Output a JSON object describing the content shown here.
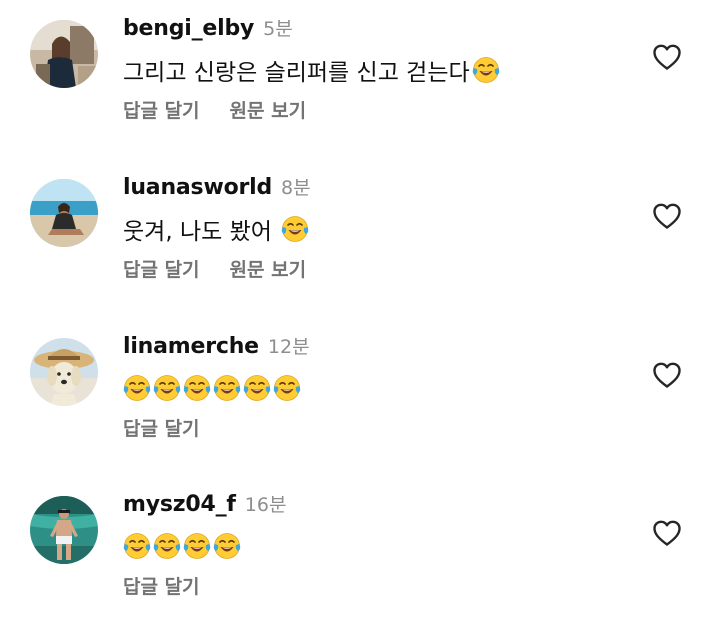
{
  "comments": [
    {
      "username": "bengi_elby",
      "time": "5분",
      "text": "그리고 신랑은 슬리퍼를 신고 걷는다",
      "emoji": [
        "face-with-tears-of-joy"
      ],
      "actions": [
        "답글 달기",
        "원문 보기"
      ]
    },
    {
      "username": "luanasworld",
      "time": "8분",
      "text": "웃겨, 나도 봤어 ",
      "emoji": [
        "face-with-tears-of-joy"
      ],
      "actions": [
        "답글 달기",
        "원문 보기"
      ]
    },
    {
      "username": "linamerche",
      "time": "12분",
      "text": "",
      "emoji": [
        "face-with-tears-of-joy",
        "face-with-tears-of-joy",
        "face-with-tears-of-joy",
        "face-with-tears-of-joy",
        "face-with-tears-of-joy",
        "face-with-tears-of-joy"
      ],
      "actions": [
        "답글 달기"
      ]
    },
    {
      "username": "mysz04_f",
      "time": "16분",
      "text": "",
      "emoji": [
        "face-with-tears-of-joy",
        "face-with-tears-of-joy",
        "face-with-tears-of-joy",
        "face-with-tears-of-joy"
      ],
      "actions": [
        "답글 달기"
      ]
    }
  ],
  "icons": {
    "like": "heart-outline-icon",
    "emoji": "face-with-tears-of-joy"
  },
  "colors": {
    "username": "#111111",
    "timestamp": "#8e8e8e",
    "action": "#737373",
    "heart_outline": "#262626",
    "emoji_face": "#FFCC33",
    "emoji_tears": "#3FA7E0"
  }
}
